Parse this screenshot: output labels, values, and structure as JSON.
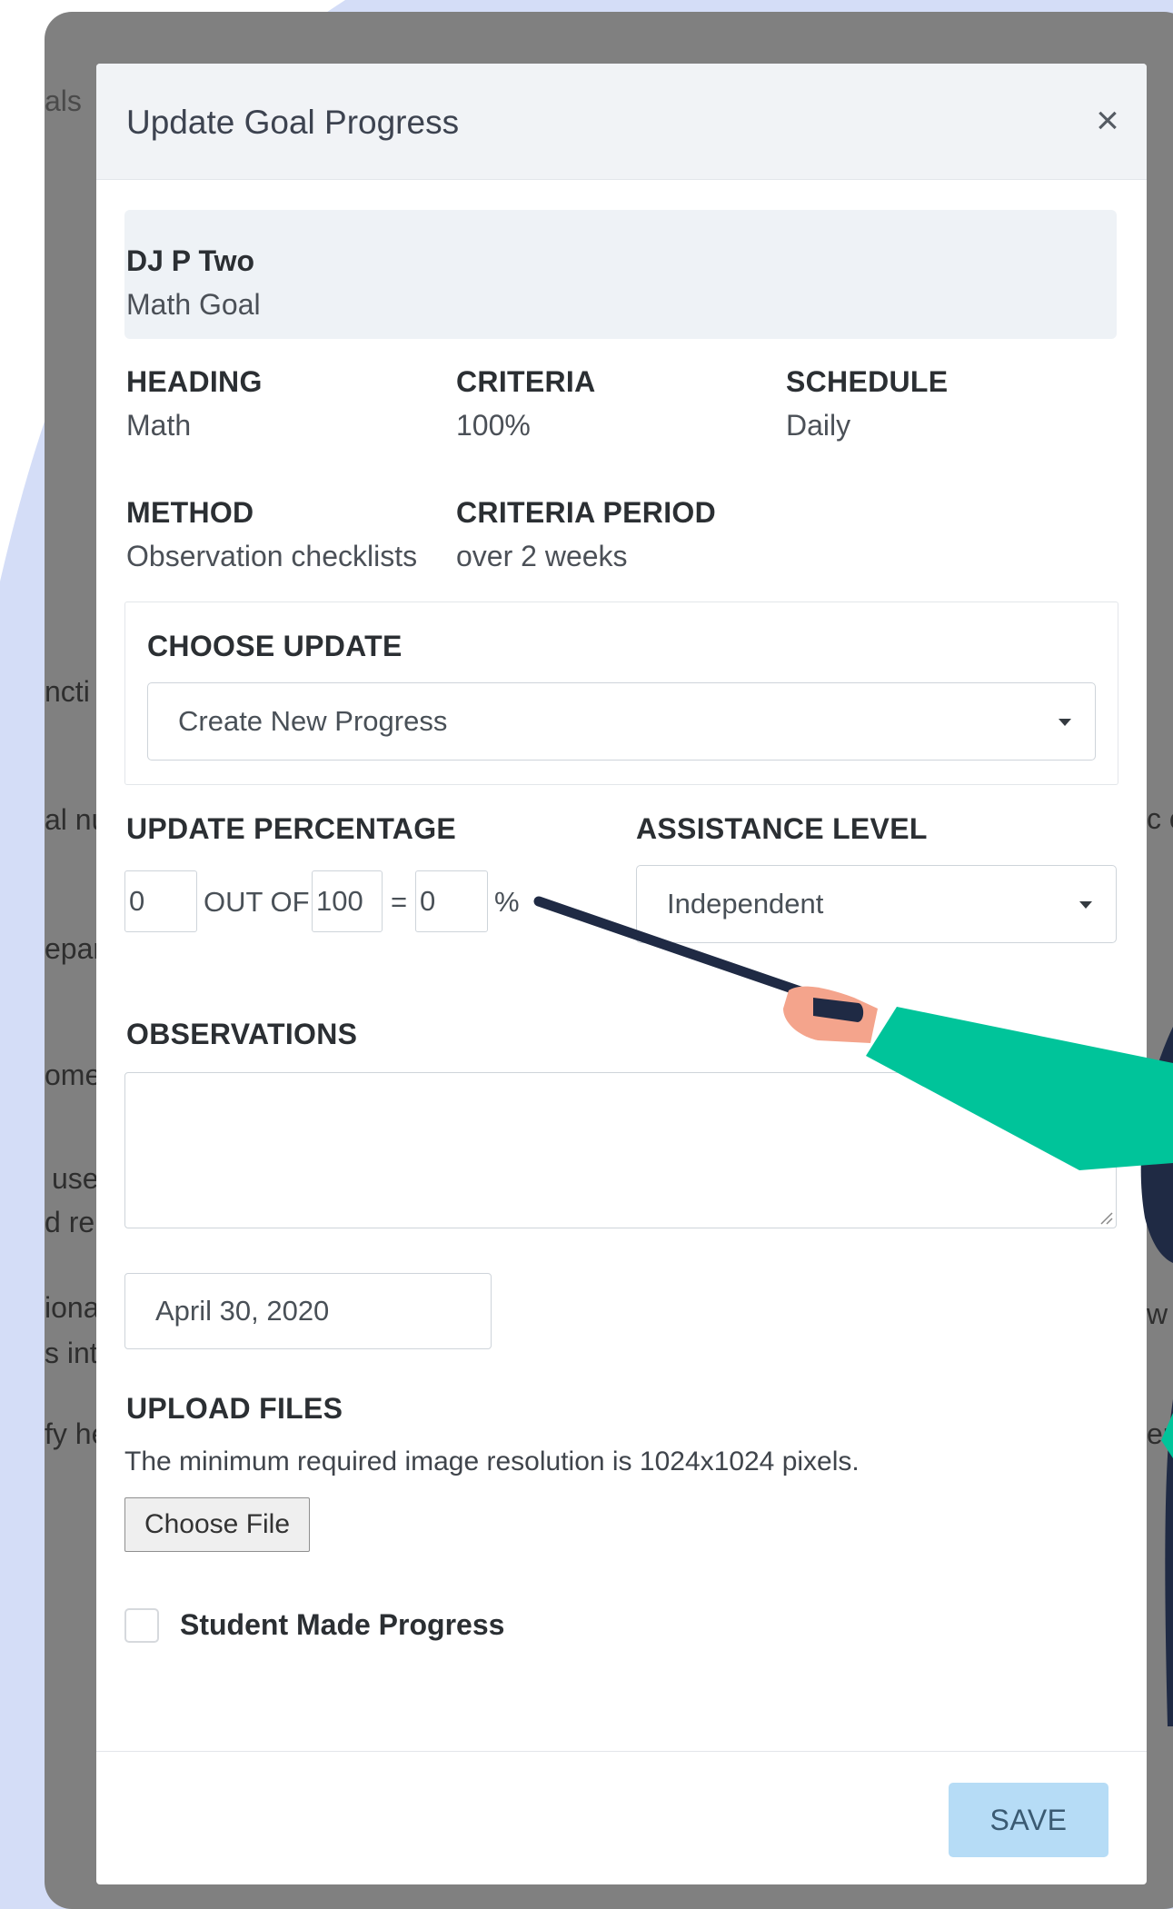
{
  "background_page": {
    "left_fragments": [
      "als",
      "ncti",
      "al nu",
      "epar",
      "ome",
      "use",
      "d re",
      "iona",
      "s int",
      "fy he"
    ],
    "right_fragments": [
      "c o",
      "w",
      "er"
    ]
  },
  "modal": {
    "title": "Update Goal Progress",
    "close_label": "×",
    "student": {
      "name": "DJ P Two",
      "goal": "Math Goal"
    },
    "details": {
      "heading_label": "HEADING",
      "heading_value": "Math",
      "criteria_label": "CRITERIA",
      "criteria_value": "100%",
      "schedule_label": "SCHEDULE",
      "schedule_value": "Daily",
      "method_label": "METHOD",
      "method_value": "Observation checklists",
      "criteria_period_label": "CRITERIA PERIOD",
      "criteria_period_value": "over 2 weeks"
    },
    "choose_update": {
      "label": "CHOOSE UPDATE",
      "selected": "Create New Progress"
    },
    "update_percentage": {
      "label": "UPDATE PERCENTAGE",
      "achieved": "0",
      "out_of_text": "OUT OF",
      "total": "100",
      "equals": "=",
      "result": "0",
      "percent_sign": "%"
    },
    "assistance_level": {
      "label": "ASSISTANCE LEVEL",
      "selected": "Independent"
    },
    "observations": {
      "label": "OBSERVATIONS",
      "value": ""
    },
    "date": {
      "value": "April 30, 2020"
    },
    "upload": {
      "label": "UPLOAD FILES",
      "help_text": "The minimum required image resolution is 1024x1024 pixels.",
      "button_label": "Choose File"
    },
    "progress_checkbox": {
      "label": "Student Made Progress",
      "checked": false
    },
    "save_label": "SAVE"
  },
  "colors": {
    "overlay": "#808080",
    "header_bg": "#f1f3f6",
    "card_bg": "#eef2f6",
    "save_button": "#b6dcf6",
    "blob": "#d4ddf7",
    "sleeve": "#00c49a",
    "pointer": "#1f2a44",
    "skin": "#f4a48c"
  }
}
